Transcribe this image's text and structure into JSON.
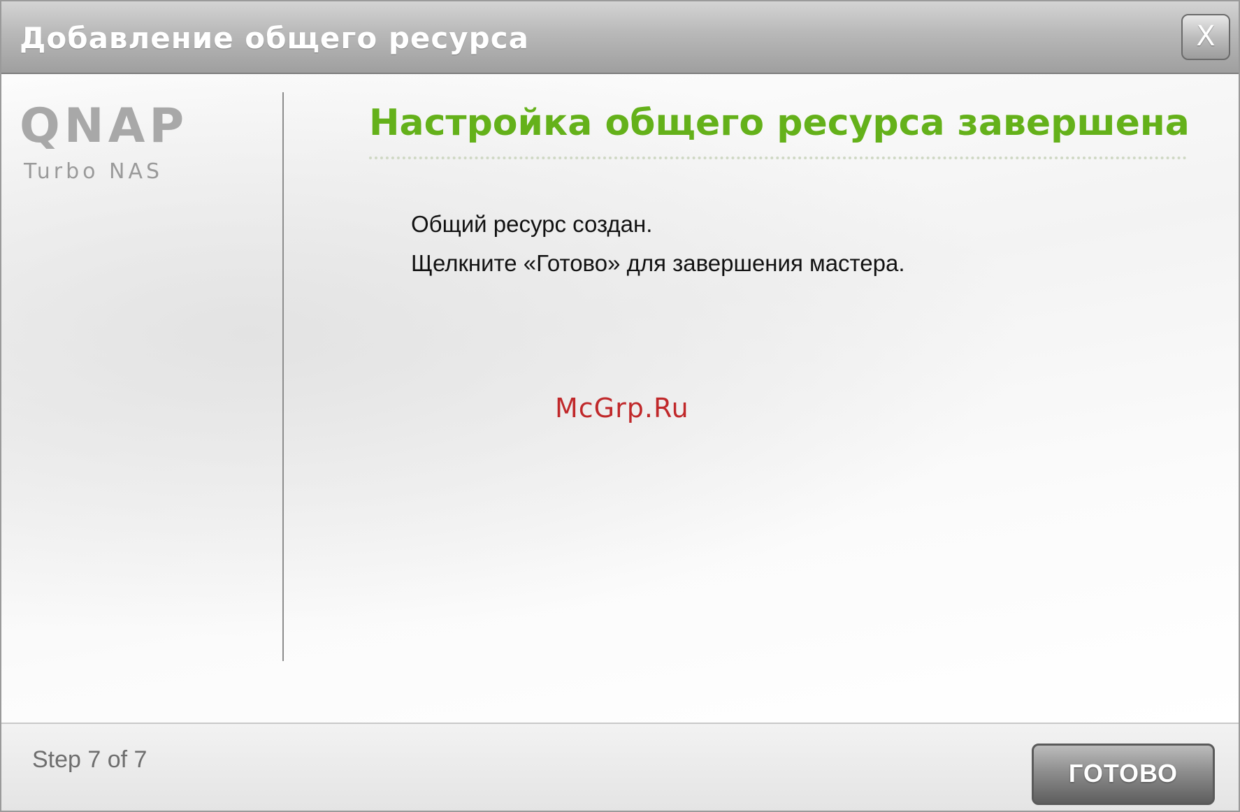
{
  "window": {
    "title": "Добавление общего ресурса",
    "close_label": "X"
  },
  "sidebar": {
    "logo_main": "QNAP",
    "logo_sub": "Turbo NAS"
  },
  "main": {
    "heading": "Настройка общего ресурса завершена",
    "message_line1": "Общий ресурс создан.",
    "message_line2": "Щелкните «Готово» для завершения мастера."
  },
  "watermark": "McGrp.Ru",
  "footer": {
    "step_text": "Step 7 of 7",
    "done_label": "ГОТОВО"
  },
  "colors": {
    "heading": "#64b11a",
    "titlebar": "#b0b0b0",
    "button": "#7a7a7a",
    "watermark": "#c0282a"
  }
}
